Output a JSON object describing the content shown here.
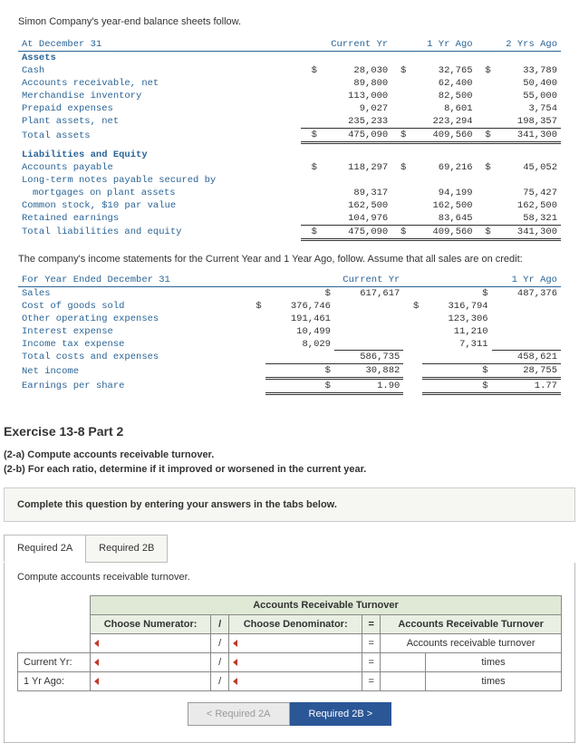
{
  "intro": "Simon Company's year-end balance sheets follow.",
  "bs": {
    "hdr_date": "At December 31",
    "col1": "Current Yr",
    "col2": "1 Yr Ago",
    "col3": "2 Yrs Ago",
    "assets_title": "Assets",
    "rows_assets": [
      {
        "label": "Cash",
        "c1": "28,030",
        "c2": "32,765",
        "c3": "33,789",
        "d": true
      },
      {
        "label": "Accounts receivable, net",
        "c1": "89,800",
        "c2": "62,400",
        "c3": "50,400"
      },
      {
        "label": "Merchandise inventory",
        "c1": "113,000",
        "c2": "82,500",
        "c3": "55,000"
      },
      {
        "label": "Prepaid expenses",
        "c1": "9,027",
        "c2": "8,601",
        "c3": "3,754"
      },
      {
        "label": "Plant assets, net",
        "c1": "235,233",
        "c2": "223,294",
        "c3": "198,357"
      }
    ],
    "total_assets": {
      "label": "Total assets",
      "c1": "475,090",
      "c2": "409,560",
      "c3": "341,300"
    },
    "liab_title": "Liabilities and Equity",
    "rows_liab": [
      {
        "label": "Accounts payable",
        "c1": "118,297",
        "c2": "69,216",
        "c3": "45,052",
        "d": true
      },
      {
        "label": "Long-term notes payable secured by",
        "nowrap": true
      },
      {
        "label": "  mortgages on plant assets",
        "c1": "89,317",
        "c2": "94,199",
        "c3": "75,427"
      },
      {
        "label": "Common stock, $10 par value",
        "c1": "162,500",
        "c2": "162,500",
        "c3": "162,500"
      },
      {
        "label": "Retained earnings",
        "c1": "104,976",
        "c2": "83,645",
        "c3": "58,321"
      }
    ],
    "total_liab": {
      "label": "Total liabilities and equity",
      "c1": "475,090",
      "c2": "409,560",
      "c3": "341,300"
    }
  },
  "inc_note": "The company's income statements for the Current Year and 1 Year Ago, follow. Assume that all sales are on credit:",
  "is": {
    "hdr": "For Year Ended December 31",
    "col1": "Current Yr",
    "col2": "1 Yr Ago",
    "sales": {
      "label": "Sales",
      "c1": "617,617",
      "c2": "487,376"
    },
    "rows": [
      {
        "label": "Cost of goods sold",
        "c1": "376,746",
        "c2": "316,794"
      },
      {
        "label": "Other operating expenses",
        "c1": "191,461",
        "c2": "123,306"
      },
      {
        "label": "Interest expense",
        "c1": "10,499",
        "c2": "11,210"
      },
      {
        "label": "Income tax expense",
        "c1": "8,029",
        "c2": "7,311"
      }
    ],
    "total_costs": {
      "label": "Total costs and expenses",
      "c1": "586,735",
      "c2": "458,621"
    },
    "net_income": {
      "label": "Net income",
      "c1": "30,882",
      "c2": "28,755"
    },
    "eps": {
      "label": "Earnings per share",
      "c1": "1.90",
      "c2": "1.77"
    }
  },
  "ex_title": "Exercise 13-8 Part 2",
  "instr_a": "(2-a) Compute accounts receivable turnover.",
  "instr_b": "(2-b) For each ratio, determine if it improved or worsened in the current year.",
  "panel_text": "Complete this question by entering your answers in the tabs below.",
  "tabs": {
    "a": "Required 2A",
    "b": "Required 2B"
  },
  "subinstr": "Compute accounts receivable turnover.",
  "ans": {
    "title": "Accounts Receivable Turnover",
    "num_hdr": "Choose Numerator:",
    "slash": "/",
    "den_hdr": "Choose Denominator:",
    "eq": "=",
    "res_hdr": "Accounts Receivable Turnover",
    "res_sub": "Accounts receivable turnover",
    "row1": "Current Yr:",
    "row2": "1 Yr Ago:",
    "unit": "times"
  },
  "nav": {
    "prev": "Required 2A",
    "next": "Required 2B"
  }
}
